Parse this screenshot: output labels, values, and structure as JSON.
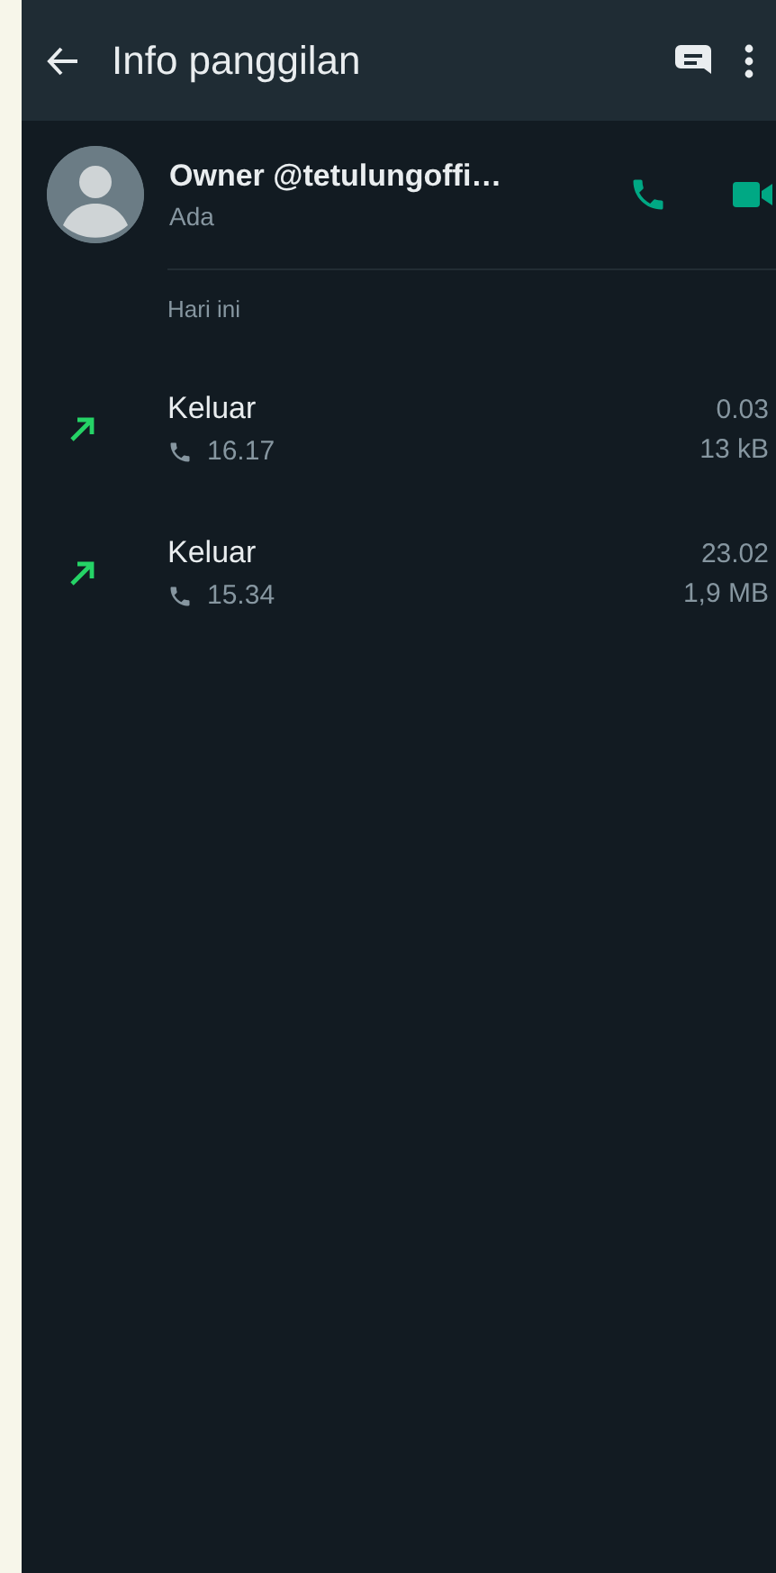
{
  "header": {
    "title": "Info panggilan"
  },
  "contact": {
    "name": "Owner @tetulungoffi…",
    "status": "Ada"
  },
  "section_label": "Hari ini",
  "calls": [
    {
      "kind": "outgoing",
      "label": "Keluar",
      "time": "16.17",
      "duration": "0.03",
      "size": "13 kB"
    },
    {
      "kind": "outgoing",
      "label": "Keluar",
      "time": "15.34",
      "duration": "23.02",
      "size": "1,9 MB"
    }
  ]
}
